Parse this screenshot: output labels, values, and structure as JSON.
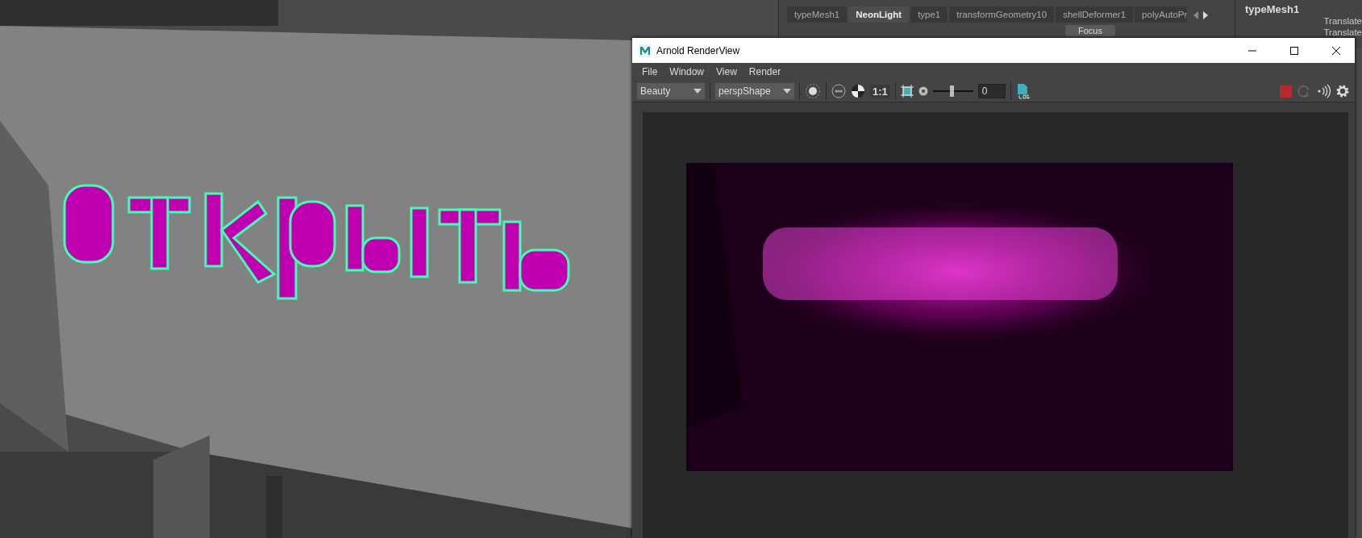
{
  "attribute_editor": {
    "tabs": [
      {
        "label": "typeMesh1",
        "selected": false
      },
      {
        "label": "NeonLight",
        "selected": true
      },
      {
        "label": "type1",
        "selected": false
      },
      {
        "label": "transformGeometry10",
        "selected": false
      },
      {
        "label": "shellDeformer1",
        "selected": false
      },
      {
        "label": "polyAutoPr",
        "selected": false
      }
    ],
    "focus_button": "Focus",
    "node_name": "typeMesh1",
    "attributes": [
      "Translate",
      "Translate"
    ]
  },
  "render_view": {
    "title": "Arnold RenderView",
    "menu": [
      "File",
      "Window",
      "View",
      "Render"
    ],
    "aov_dropdown": "Beauty",
    "camera_dropdown": "perspShape",
    "zoom_label": "1:1",
    "exposure": {
      "level": 0.46,
      "value": "0"
    }
  }
}
